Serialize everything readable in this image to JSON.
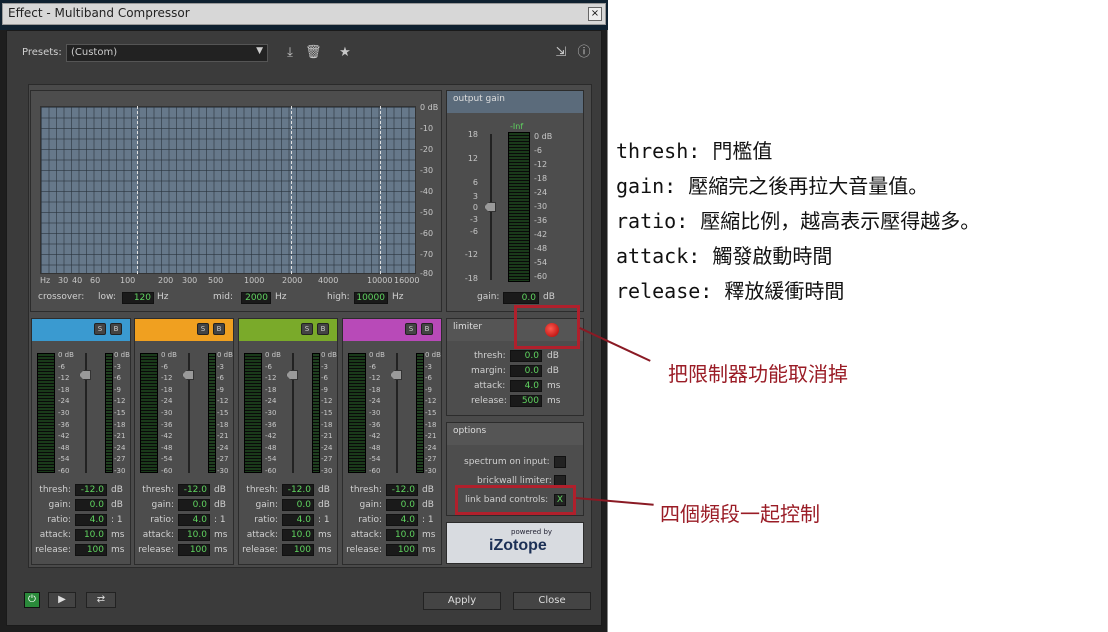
{
  "window": {
    "title": "Effect - Multiband Compressor",
    "close": "×"
  },
  "presets": {
    "label": "Presets:",
    "value": "(Custom)"
  },
  "graph": {
    "db_ticks": [
      "0 dB",
      "-10",
      "-20",
      "-30",
      "-40",
      "-50",
      "-60",
      "-70",
      "-80"
    ],
    "freq_ticks": [
      "Hz",
      "30",
      "40",
      "60",
      "100",
      "200",
      "300",
      "500",
      "1000",
      "2000",
      "4000",
      "10000",
      "16000"
    ]
  },
  "crossover": {
    "label": "crossover:",
    "low_label": "low:",
    "low": "120",
    "mid_label": "mid:",
    "mid": "2000",
    "high_label": "high:",
    "high": "10000",
    "unit": "Hz"
  },
  "output_gain": {
    "title": "output gain",
    "peak": "-Inf",
    "left_scale": [
      "18",
      "12",
      "6",
      "3",
      "0",
      "-3",
      "-6",
      "-12",
      "-18"
    ],
    "right_scale": [
      "0 dB",
      "-6",
      "-12",
      "-18",
      "-24",
      "-30",
      "-36",
      "-42",
      "-48",
      "-54",
      "-60"
    ],
    "gain_label": "gain:",
    "gain": "0.0",
    "unit": "dB"
  },
  "limiter": {
    "title": "limiter",
    "thresh_label": "thresh:",
    "thresh": "0.0",
    "margin_label": "margin:",
    "margin": "0.0",
    "attack_label": "attack:",
    "attack": "4.0",
    "release_label": "release:",
    "release": "500",
    "db": "dB",
    "ms": "ms"
  },
  "options": {
    "title": "options",
    "spectrum": "spectrum on input:",
    "brickwall": "brickwall limiter:",
    "link": "link band controls:",
    "link_checked": "X"
  },
  "brand": {
    "powered": "powered by",
    "name": "iZotope"
  },
  "band_scale_left": [
    "0 dB",
    "-6",
    "-12",
    "-18",
    "-24",
    "-30",
    "-36",
    "-42",
    "-48",
    "-54",
    "-60"
  ],
  "band_scale_right": [
    "0 dB",
    "-3",
    "-6",
    "-9",
    "-12",
    "-15",
    "-18",
    "-21",
    "-24",
    "-27",
    "-30"
  ],
  "band_labels": {
    "thresh": "thresh:",
    "gain": "gain:",
    "ratio": "ratio:",
    "attack": "attack:",
    "release": "release:",
    "db": "dB",
    "ms": "ms",
    "ratio_unit": ": 1",
    "s": "S",
    "b": "B"
  },
  "bands": [
    {
      "color": "#3a9ad0",
      "thresh": "-12.0",
      "gain": "0.0",
      "ratio": "4.0",
      "attack": "10.0",
      "release": "100"
    },
    {
      "color": "#f0a020",
      "thresh": "-12.0",
      "gain": "0.0",
      "ratio": "4.0",
      "attack": "10.0",
      "release": "100"
    },
    {
      "color": "#7aaa2a",
      "thresh": "-12.0",
      "gain": "0.0",
      "ratio": "4.0",
      "attack": "10.0",
      "release": "100"
    },
    {
      "color": "#b84ab8",
      "thresh": "-12.0",
      "gain": "0.0",
      "ratio": "4.0",
      "attack": "10.0",
      "release": "100"
    }
  ],
  "footer": {
    "apply": "Apply",
    "close": "Close"
  },
  "annotations": {
    "notes": [
      "thresh: 門檻值",
      "gain: 壓縮完之後再拉大音量值。",
      "ratio: 壓縮比例，越高表示壓得越多。",
      "attack: 觸發啟動時間",
      "release: 釋放緩衝時間"
    ],
    "limiter_note": "把限制器功能取消掉",
    "link_note": "四個頻段一起控制"
  }
}
